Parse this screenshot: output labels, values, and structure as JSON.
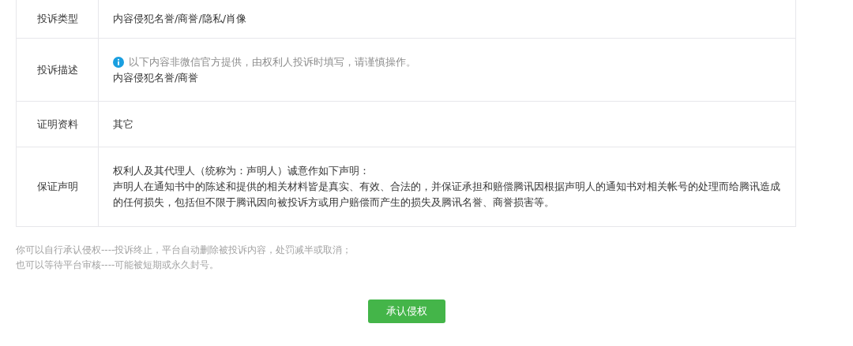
{
  "table": {
    "rows": [
      {
        "kind": "text",
        "label": "投诉类型",
        "value": "内容侵犯名誉/商誉/隐私/肖像"
      },
      {
        "kind": "notice",
        "label": "投诉描述",
        "notice": "以下内容非微信官方提供，由权利人投诉时填写，请谨慎操作。",
        "value": "内容侵犯名誉/商誉"
      },
      {
        "kind": "text",
        "label": "证明资料",
        "value": "其它"
      },
      {
        "kind": "statement",
        "label": "保证声明",
        "heading": "权利人及其代理人（统称为：声明人）诚意作如下声明：",
        "value": "声明人在通知书中的陈述和提供的相关材料皆是真实、有效、合法的，并保证承担和赔偿腾讯因根据声明人的通知书对相关帐号的处理而给腾讯造成的任何损失，包括但不限于腾讯因向被投诉方或用户赔偿而产生的损失及腾讯名誉、商誉损害等。"
      }
    ]
  },
  "notes": [
    "你可以自行承认侵权----投诉终止，平台自动删除被投诉内容，处罚减半或取消；",
    "也可以等待平台审核----可能被短期或永久封号。"
  ],
  "button": "承认侵权"
}
